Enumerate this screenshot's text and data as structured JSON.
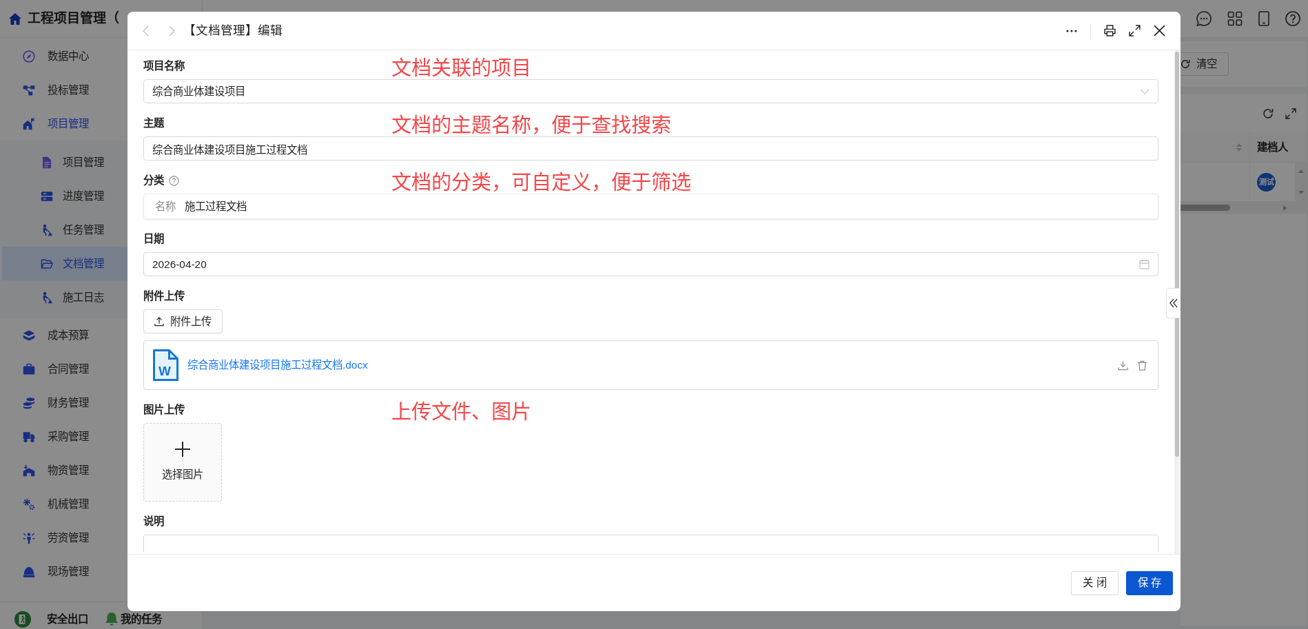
{
  "sidebar": {
    "title": "工程项目管理（",
    "items": [
      {
        "label": "数据中心",
        "selected": false,
        "expanded": false
      },
      {
        "label": "投标管理",
        "selected": false,
        "expanded": false
      },
      {
        "label": "项目管理",
        "selected": false,
        "expanded": true,
        "children": [
          {
            "label": "项目管理",
            "selected": false
          },
          {
            "label": "进度管理",
            "selected": false
          },
          {
            "label": "任务管理",
            "selected": false
          },
          {
            "label": "文档管理",
            "selected": true
          },
          {
            "label": "施工日志",
            "selected": false
          }
        ]
      },
      {
        "label": "成本预算",
        "selected": false,
        "expanded": false
      },
      {
        "label": "合同管理",
        "selected": false,
        "expanded": false
      },
      {
        "label": "财务管理",
        "selected": false,
        "expanded": false
      },
      {
        "label": "采购管理",
        "selected": false,
        "expanded": false
      },
      {
        "label": "物资管理",
        "selected": false,
        "expanded": false
      },
      {
        "label": "机械管理",
        "selected": false,
        "expanded": false
      },
      {
        "label": "劳资管理",
        "selected": false,
        "expanded": false
      },
      {
        "label": "现场管理",
        "selected": false,
        "expanded": false
      }
    ],
    "footer_links": [
      {
        "label": "安全出口"
      },
      {
        "label": "我的任务"
      }
    ]
  },
  "search_panel": {
    "reset_button": "清空"
  },
  "table": {
    "columns": [
      {
        "sortable": true
      },
      {
        "label": "建档人",
        "sortable": false
      }
    ],
    "rows": [
      {
        "creator": "测试"
      }
    ]
  },
  "dialog": {
    "title": "【文档管理】编辑",
    "nav_buttons": [
      {
        "disabled": true
      },
      {
        "disabled": true
      }
    ],
    "fields": [
      {
        "kind": "select",
        "label": "项目名称",
        "help": false,
        "value": "综合商业体建设项目",
        "note": "文档关联的项目"
      },
      {
        "kind": "text",
        "label": "主题",
        "help": false,
        "value": "综合商业体建设项目施工过程文档",
        "note": "文档的主题名称，便于查找搜索"
      },
      {
        "kind": "keyvalue",
        "label": "分类",
        "help": true,
        "prefix": "名称",
        "value": "施工过程文档",
        "note": "文档的分类，可自定义，便于筛选"
      },
      {
        "kind": "date",
        "label": "日期",
        "help": false,
        "value": "2026-04-20"
      },
      {
        "kind": "attachments",
        "label": "附件上传",
        "help": false,
        "button": "附件上传",
        "files": [
          {
            "name": "综合商业体建设项目施工过程文档.docx",
            "icon_text": "W"
          }
        ]
      },
      {
        "kind": "images",
        "label": "图片上传",
        "help": false,
        "button": "选择图片",
        "note": "上传文件、图片"
      },
      {
        "kind": "textarea",
        "label": "说明",
        "help": false
      }
    ],
    "buttons": [
      {
        "label": "关 闭",
        "primary": false
      },
      {
        "label": "保 存",
        "primary": true
      }
    ]
  }
}
